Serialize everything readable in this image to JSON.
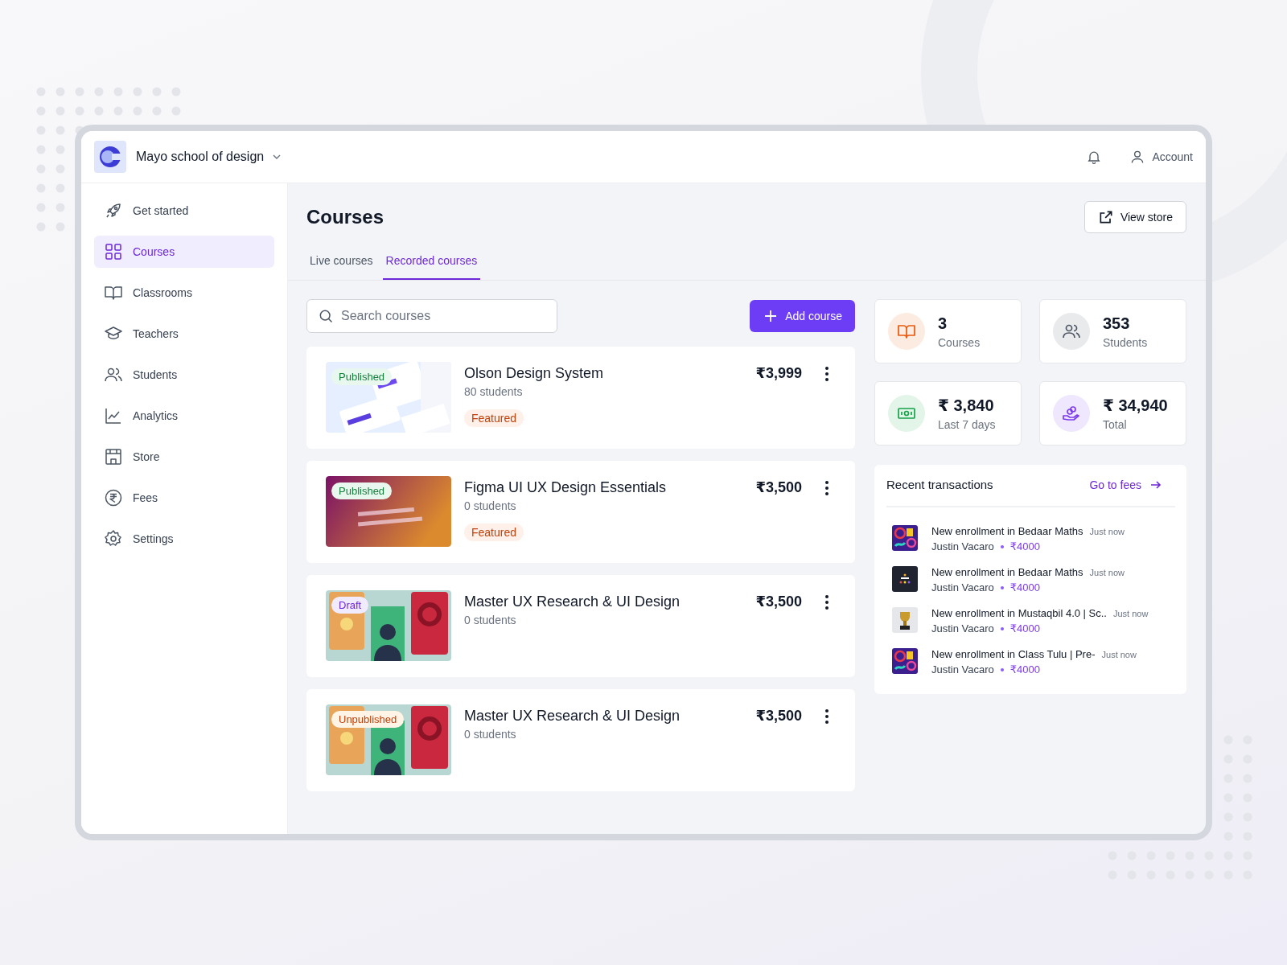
{
  "header": {
    "school": "Mayo school of design",
    "account": "Account"
  },
  "sidebar": {
    "items": [
      {
        "label": "Get started",
        "selected": false
      },
      {
        "label": "Courses",
        "selected": true
      },
      {
        "label": "Classrooms",
        "selected": false
      },
      {
        "label": "Teachers",
        "selected": false
      },
      {
        "label": "Students",
        "selected": false
      },
      {
        "label": "Analytics",
        "selected": false
      },
      {
        "label": "Store",
        "selected": false
      },
      {
        "label": "Fees",
        "selected": false
      },
      {
        "label": "Settings",
        "selected": false
      }
    ]
  },
  "page": {
    "title": "Courses",
    "view_store": "View store"
  },
  "tabs": [
    {
      "label": "Live courses",
      "selected": false
    },
    {
      "label": "Recorded courses",
      "selected": true
    }
  ],
  "search": {
    "placeholder": "Search courses"
  },
  "add_course": "Add course",
  "courses": [
    {
      "status": "Published",
      "kind": "published",
      "title": "Olson Design System",
      "students": "80 students",
      "price": "₹3,999",
      "featured": true,
      "featured_label": "Featured"
    },
    {
      "status": "Published",
      "kind": "published",
      "title": "Figma UI UX Design Essentials",
      "students": "0 students",
      "price": "₹3,500",
      "featured": true,
      "featured_label": "Featured"
    },
    {
      "status": "Draft",
      "kind": "draft",
      "title": "Master UX Research & UI Design",
      "students": "0 students",
      "price": "₹3,500",
      "featured": false
    },
    {
      "status": "Unpublished",
      "kind": "unpublished",
      "title": "Master UX Research & UI Design",
      "students": "0 students",
      "price": "₹3,500",
      "featured": false
    }
  ],
  "stats": [
    {
      "value": "3",
      "label": "Courses",
      "color": "#ea580c"
    },
    {
      "value": "353",
      "label": "Students",
      "color": "#4b5563"
    },
    {
      "value": "₹ 3,840",
      "label": "Last 7 days",
      "color": "#16a34a"
    },
    {
      "value": "₹ 34,940",
      "label": "Total",
      "color": "#7c3aed"
    }
  ],
  "transactions": {
    "title": "Recent transactions",
    "link": "Go to fees",
    "items": [
      {
        "text": "New enrollment in Bedaar Maths",
        "time": "Just now",
        "name": "Justin Vacaro",
        "amount": "₹4000"
      },
      {
        "text": "New enrollment in Bedaar Maths",
        "time": "Just now",
        "name": "Justin Vacaro",
        "amount": "₹4000"
      },
      {
        "text": "New enrollment in Mustaqbil 4.0 | Sc..",
        "time": "Just now",
        "name": "Justin Vacaro",
        "amount": "₹4000"
      },
      {
        "text": "New enrollment in Class Tulu | Pre-",
        "time": "Just now",
        "name": "Justin Vacaro",
        "amount": "₹4000"
      }
    ]
  }
}
